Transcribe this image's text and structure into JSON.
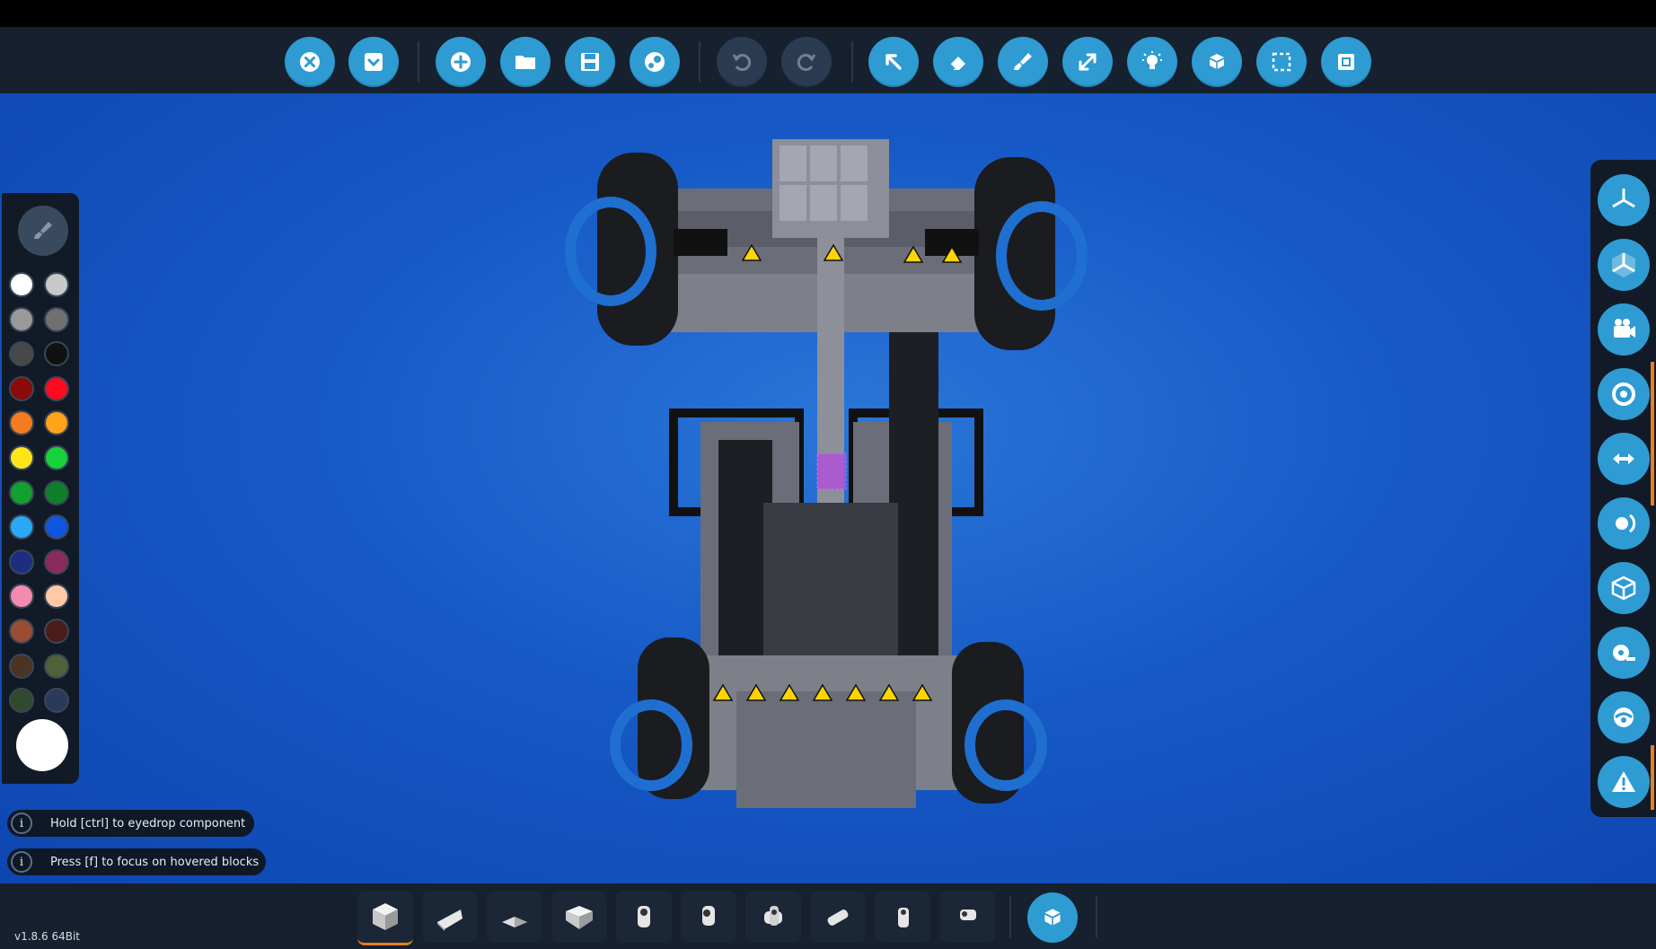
{
  "toolbar": {
    "buttons": [
      {
        "name": "close-button",
        "icon": "close-icon"
      },
      {
        "name": "inventory-button",
        "icon": "down-arrow-box-icon"
      },
      {
        "name": "new-button",
        "icon": "add-icon"
      },
      {
        "name": "open-button",
        "icon": "folder-icon"
      },
      {
        "name": "save-button",
        "icon": "save-icon"
      },
      {
        "name": "workshop-button",
        "icon": "steam-icon"
      },
      {
        "name": "undo-button",
        "icon": "undo-icon",
        "disabled": true
      },
      {
        "name": "redo-button",
        "icon": "redo-icon",
        "disabled": true
      },
      {
        "name": "select-tool-button",
        "icon": "cursor-icon"
      },
      {
        "name": "eraser-tool-button",
        "icon": "eraser-icon"
      },
      {
        "name": "paint-tool-button",
        "icon": "paintbrush-icon"
      },
      {
        "name": "move-tool-button",
        "icon": "resize-arrow-icon"
      },
      {
        "name": "lighting-button",
        "icon": "lightbulb-icon"
      },
      {
        "name": "logic-view-button",
        "icon": "blocks-icon"
      },
      {
        "name": "selection-box-button",
        "icon": "dashed-select-icon"
      },
      {
        "name": "microcontroller-button",
        "icon": "chip-icon"
      }
    ]
  },
  "palette": {
    "colors": [
      "#ffffff",
      "#c8c8c8",
      "#9a9a9a",
      "#707070",
      "#484848",
      "#111111",
      "#8b0a0a",
      "#ff0a1e",
      "#f57b1e",
      "#ffa31a",
      "#ffe51a",
      "#17d23b",
      "#12a02e",
      "#0d7f2a",
      "#2ba8f5",
      "#1055e0",
      "#1d2e82",
      "#8b2a5e",
      "#f58ab0",
      "#ffc9a6",
      "#9a4c34",
      "#4a1e18",
      "#4a3524",
      "#4f6138",
      "#2f4a2c",
      "#2a3a5a"
    ],
    "current_color": "#ffffff"
  },
  "hints": [
    {
      "text": "Hold [ctrl] to eyedrop component"
    },
    {
      "text": "Press [f] to focus on hovered blocks"
    }
  ],
  "viewbar": {
    "buttons": [
      {
        "name": "view-axis-button",
        "icon": "axis-icon"
      },
      {
        "name": "view-axis-3d-button",
        "icon": "axis-3d-icon"
      },
      {
        "name": "camera-button",
        "icon": "camera-icon"
      },
      {
        "name": "center-of-mass-button",
        "icon": "target-icon"
      },
      {
        "name": "thrust-view-button",
        "icon": "arrows-icon"
      },
      {
        "name": "rotation-view-button",
        "icon": "rotate-icon"
      },
      {
        "name": "bounds-view-button",
        "icon": "cube-outline-icon"
      },
      {
        "name": "measure-button",
        "icon": "tape-measure-icon"
      },
      {
        "name": "hide-view-button",
        "icon": "eye-icon"
      },
      {
        "name": "warnings-button",
        "icon": "warning-icon"
      }
    ]
  },
  "bottombar": {
    "blocks": [
      {
        "name": "block-cube",
        "icon": "cube-block-icon"
      },
      {
        "name": "block-wedge",
        "icon": "wedge-block-icon"
      },
      {
        "name": "block-pyramid",
        "icon": "pyramid-block-icon"
      },
      {
        "name": "block-inverted-wedge",
        "icon": "inverted-wedge-block-icon"
      },
      {
        "name": "block-pipe-1",
        "icon": "pipe-block-icon"
      },
      {
        "name": "block-pipe-2",
        "icon": "pipe-block-icon"
      },
      {
        "name": "block-pipe-3",
        "icon": "pipe-block-icon"
      },
      {
        "name": "block-pipe-4",
        "icon": "pipe-block-icon"
      },
      {
        "name": "block-pipe-5",
        "icon": "pipe-block-icon"
      },
      {
        "name": "block-pipe-6",
        "icon": "pipe-block-icon"
      }
    ],
    "inventory_icon": "blocks-icon"
  },
  "version": "v1.8.6 64Bit"
}
